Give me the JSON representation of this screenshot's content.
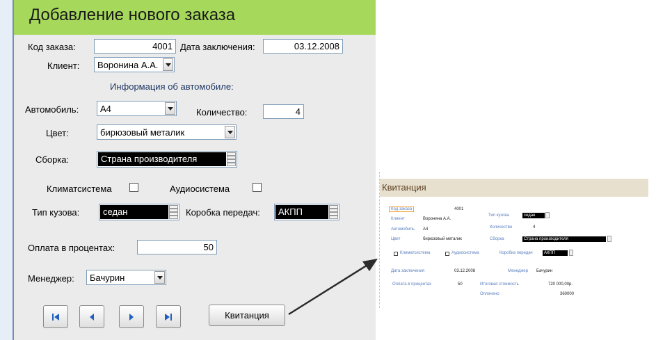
{
  "form": {
    "title": "Добавление нового заказа",
    "order_code_label": "Код заказа:",
    "order_code_value": "4001",
    "date_label": "Дата заключения:",
    "date_value": "03.12.2008",
    "client_label": "Клиент:",
    "client_value": "Воронина А.А.",
    "car_info_heading": "Информация об автомобиле:",
    "car_label": "Автомобиль:",
    "car_value": "А4",
    "quantity_label": "Количество:",
    "quantity_value": "4",
    "color_label": "Цвет:",
    "color_value": "бирюзовый металик",
    "assembly_label": "Сборка:",
    "assembly_value": "Страна производителя",
    "climate_label": "Климатсистема",
    "climate_checked": false,
    "audio_label": "Аудиосистема",
    "audio_checked": false,
    "body_type_label": "Тип кузова:",
    "body_type_value": "седан",
    "gearbox_label": "Коробка передач:",
    "gearbox_value": "АКПП",
    "payment_label": "Оплата в процентах:",
    "payment_value": "50",
    "manager_label": "Менеджер:",
    "manager_value": "Бачурин",
    "receipt_button": "Квитанция"
  },
  "preview": {
    "title": "Квитанция",
    "order_code_label": "Код заказа",
    "order_code_value": "4001",
    "client_label": "Клиент",
    "client_value": "Воронина А.А.",
    "car_label": "Автомобиль",
    "car_value": "А4",
    "color_label": "Цвет",
    "color_value": "бирюзовый металик",
    "body_type_label": "Тип кузова",
    "body_type_value": "седан",
    "quantity_label": "Количество",
    "quantity_value": "4",
    "assembly_label": "Сборка",
    "assembly_value": "Страна производителя",
    "climate_label": "Климатсистема",
    "audio_label": "Аудиосистема",
    "gearbox_label": "Коробка передач",
    "gearbox_value": "АКПП",
    "date_label": "Дата заключения",
    "date_value": "03.12.2008",
    "manager_label": "Менеджер",
    "manager_value": "Бачурин",
    "payment_label": "Оплата в процентах",
    "payment_value": "50",
    "total_label": "Итоговая стоимость",
    "total_value": "720 000,00р.",
    "paid_label": "Оплачено",
    "paid_value": "360000"
  },
  "colors": {
    "header_green": "#a6d95b",
    "form_bg": "#ebebeb",
    "preview_header": "#e8e0cf",
    "label_blue": "#5a7fbf"
  }
}
